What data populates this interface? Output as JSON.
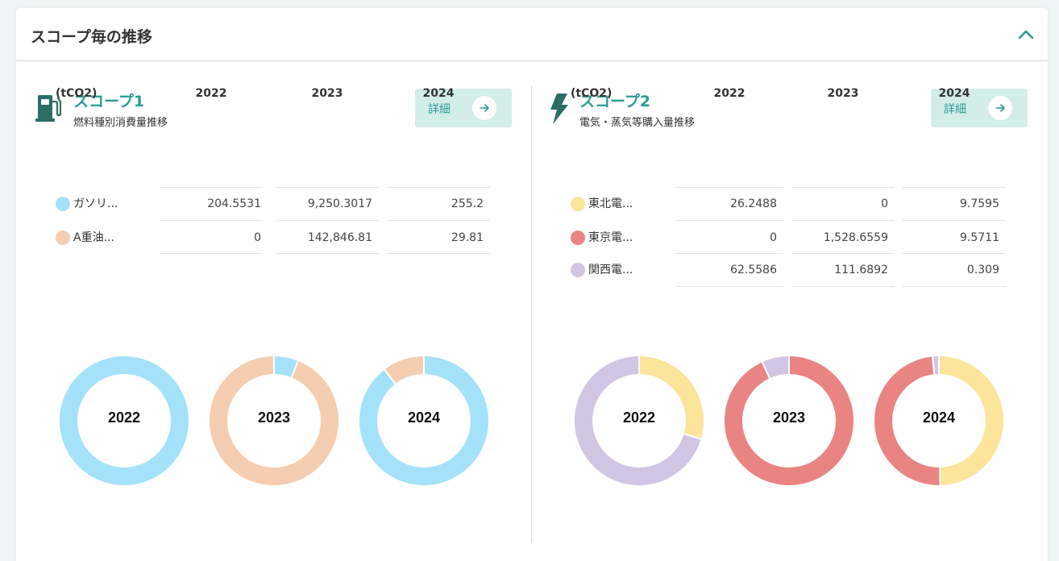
{
  "header": {
    "title": "スコープ毎の推移"
  },
  "colors": {
    "accent": "#2a9d93",
    "gasoline": "#a4e2fa",
    "heavy_oil": "#f5cdb0",
    "tohoku": "#fce49a",
    "tokyo": "#ea8482",
    "kansai": "#d1c5e4"
  },
  "scope1": {
    "title": "スコープ1",
    "subtitle": "燃料種別消費量推移",
    "detail_label": "詳細",
    "icon": "fuel-pump-icon",
    "unit": "(tCO2)",
    "years": [
      "2022",
      "2023",
      "2024"
    ],
    "rows": [
      {
        "label": "ガソリ...",
        "color": "#a4e2fa",
        "values": [
          "204.5531",
          "9,250.3017",
          "255.2"
        ]
      },
      {
        "label": "A重油...",
        "color": "#f5cdb0",
        "values": [
          "0",
          "142,846.81",
          "29.81"
        ]
      }
    ]
  },
  "scope2": {
    "title": "スコープ2",
    "subtitle": "電気・蒸気等購入量推移",
    "detail_label": "詳細",
    "icon": "lightning-icon",
    "unit": "(tCO2)",
    "years": [
      "2022",
      "2023",
      "2024"
    ],
    "rows": [
      {
        "label": "東北電...",
        "color": "#fce49a",
        "values": [
          "26.2488",
          "0",
          "9.7595"
        ]
      },
      {
        "label": "東京電...",
        "color": "#ea8482",
        "values": [
          "0",
          "1,528.6559",
          "9.5711"
        ]
      },
      {
        "label": "関西電...",
        "color": "#d1c5e4",
        "values": [
          "62.5586",
          "111.6892",
          "0.309"
        ]
      }
    ]
  },
  "chart_data": [
    {
      "type": "pie",
      "title": "2022",
      "series": [
        {
          "name": "ガソリ...",
          "color": "#a4e2fa",
          "value": 204.5531
        },
        {
          "name": "A重油...",
          "color": "#f5cdb0",
          "value": 0
        }
      ]
    },
    {
      "type": "pie",
      "title": "2023",
      "series": [
        {
          "name": "ガソリ...",
          "color": "#a4e2fa",
          "value": 9250.3017
        },
        {
          "name": "A重油...",
          "color": "#f5cdb0",
          "value": 142846.81
        }
      ]
    },
    {
      "type": "pie",
      "title": "2024",
      "series": [
        {
          "name": "ガソリ...",
          "color": "#a4e2fa",
          "value": 255.2
        },
        {
          "name": "A重油...",
          "color": "#f5cdb0",
          "value": 29.81
        }
      ]
    },
    {
      "type": "pie",
      "title": "2022",
      "series": [
        {
          "name": "東北電...",
          "color": "#fce49a",
          "value": 26.2488
        },
        {
          "name": "東京電...",
          "color": "#ea8482",
          "value": 0
        },
        {
          "name": "関西電...",
          "color": "#d1c5e4",
          "value": 62.5586
        }
      ]
    },
    {
      "type": "pie",
      "title": "2023",
      "series": [
        {
          "name": "東北電...",
          "color": "#fce49a",
          "value": 0
        },
        {
          "name": "東京電...",
          "color": "#ea8482",
          "value": 1528.6559
        },
        {
          "name": "関西電...",
          "color": "#d1c5e4",
          "value": 111.6892
        }
      ]
    },
    {
      "type": "pie",
      "title": "2024",
      "series": [
        {
          "name": "東北電...",
          "color": "#fce49a",
          "value": 9.7595
        },
        {
          "name": "東京電...",
          "color": "#ea8482",
          "value": 9.5711
        },
        {
          "name": "関西電...",
          "color": "#d1c5e4",
          "value": 0.309
        }
      ]
    }
  ]
}
